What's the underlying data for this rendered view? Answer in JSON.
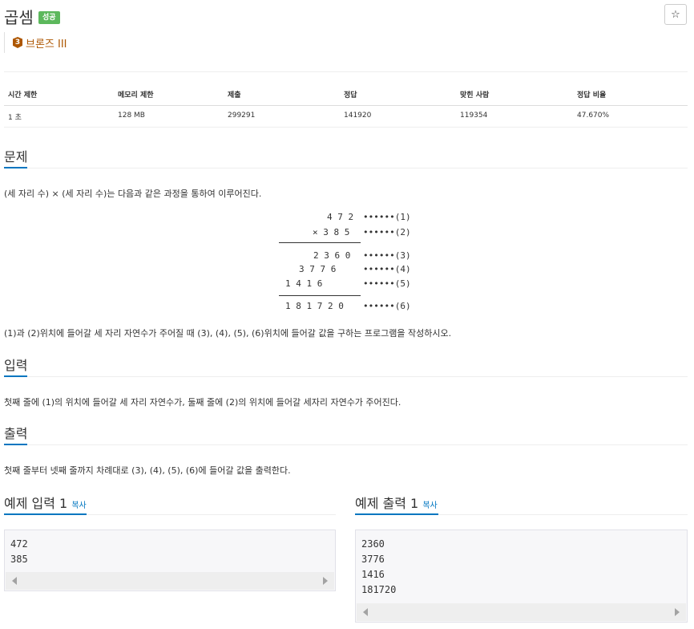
{
  "problem": {
    "title": "곱셈",
    "badge": "성공",
    "tier_number": "3",
    "tier_label": "브론즈 III",
    "star_icon": "☆"
  },
  "stats": {
    "headers": [
      "시간 제한",
      "메모리 제한",
      "제출",
      "정답",
      "맞힌 사람",
      "정답 비율"
    ],
    "values": [
      "1 초",
      "128 MB",
      "299291",
      "141920",
      "119354",
      "47.670%"
    ]
  },
  "sections": {
    "problem_title": "문제",
    "problem_text": "(세 자리 수) × (세 자리 수)는 다음과 같은 과정을 통하여 이루어진다.",
    "problem_text2": "(1)과 (2)위치에 들어갈 세 자리 자연수가 주어질 때 (3), (4), (5), (6)위치에 들어갈 값을 구하는 프로그램을 작성하시오.",
    "input_title": "입력",
    "input_text": "첫째 줄에 (1)의 위치에 들어갈 세 자리 자연수가, 둘째 줄에 (2)의 위치에 들어갈 세자리 자연수가 주어진다.",
    "output_title": "출력",
    "output_text": "첫째 줄부터 넷째 줄까지 차례대로 (3), (4), (5), (6)에 들어갈 값을 출력한다."
  },
  "multiplication": {
    "rows": [
      {
        "digits": "4 7 2",
        "label": "••••••(1)"
      },
      {
        "digits": "× 3 8 5",
        "label": "••••••(2)"
      },
      {
        "digits": "2 3 6 0",
        "label": "••••••(3)"
      },
      {
        "digits": "3 7 7 6",
        "label": "••••••(4)"
      },
      {
        "digits": "1 4 1 6",
        "label": "••••••(5)"
      },
      {
        "digits": "1 8 1 7 2 0",
        "label": "••••••(6)"
      }
    ]
  },
  "samples": {
    "input_title": "예제 입력 1",
    "output_title": "예제 출력 1",
    "copy_label": "복사",
    "input_lines": [
      "472",
      "385"
    ],
    "output_lines": [
      "2360",
      "3776",
      "1416",
      "181720"
    ]
  }
}
